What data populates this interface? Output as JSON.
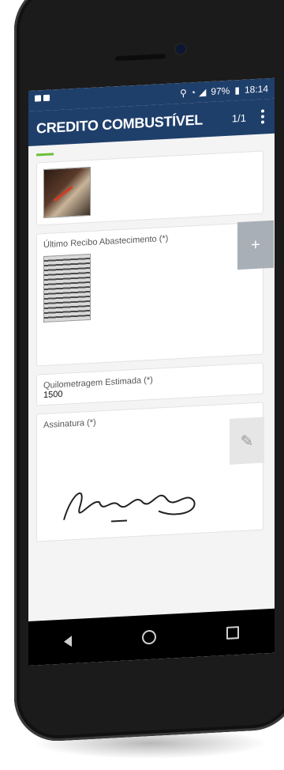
{
  "status_bar": {
    "battery": "97%",
    "time": "18:14",
    "icons": [
      "location-icon",
      "wifi-icon",
      "signal-icon",
      "battery-icon"
    ]
  },
  "app_bar": {
    "title": "CREDITO COMBUSTÍVEL",
    "page_counter": "1/1",
    "menu_icon": "kebab-icon"
  },
  "form": {
    "progress_fraction": 0.1,
    "photo_field": {
      "has_image": true
    },
    "receipt_field": {
      "label": "Último Recibo Abastecimento (*)",
      "add_label": "+"
    },
    "mileage_field": {
      "label": "Quilometragem Estimada (*)",
      "value": "1500"
    },
    "signature_field": {
      "label": "Assinatura (*)",
      "edit_icon": "pencil-icon"
    }
  },
  "nav_bar": {
    "icons": [
      "back-icon",
      "home-icon",
      "recents-icon"
    ]
  },
  "colors": {
    "app_bar": "#1f3f6b",
    "progress": "#6cbf3a",
    "plus_button": "#a8afb7"
  }
}
